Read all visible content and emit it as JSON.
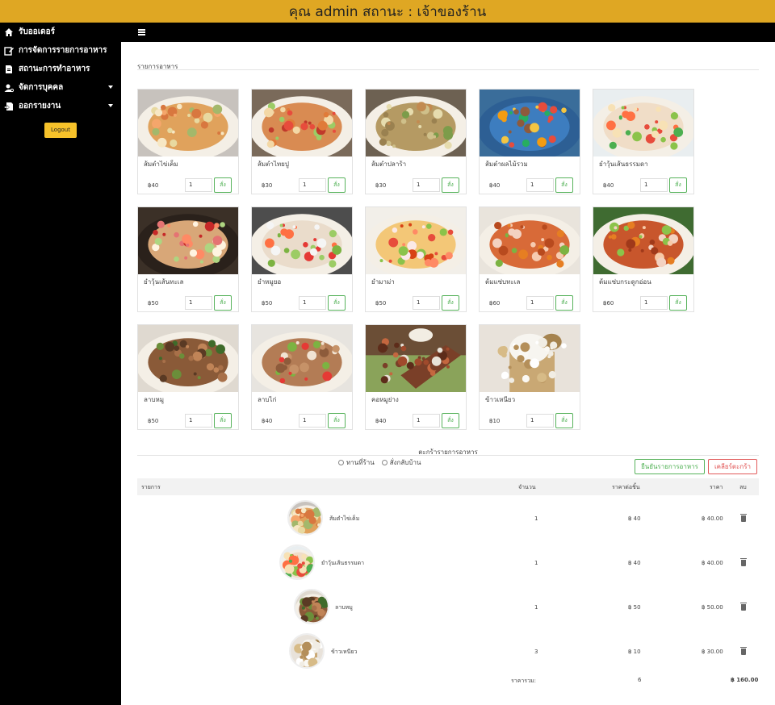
{
  "header": {
    "title": "คุณ admin สถานะ : เจ้าของร้าน"
  },
  "sidebar": {
    "items": [
      {
        "label": "รับออเดอร์",
        "icon": "home-icon",
        "has_caret": false
      },
      {
        "label": "การจัดการรายการอาหาร",
        "icon": "edit-icon",
        "has_caret": false
      },
      {
        "label": "สถานะการทำอาหาร",
        "icon": "file-icon",
        "has_caret": false
      },
      {
        "label": "จัดการบุคคล",
        "icon": "user-cog-icon",
        "has_caret": true
      },
      {
        "label": "ออกรายงาน",
        "icon": "report-icon",
        "has_caret": true
      }
    ],
    "logout_label": "Logout"
  },
  "menu": {
    "section_title": "รายการอาหาร",
    "order_label": "สั่ง",
    "items": [
      {
        "name": "ส้มตำไข่เค็ม",
        "price": "฿40",
        "qty": "1",
        "image": "papaya-salad-salted-egg"
      },
      {
        "name": "ส้มตำไทยปู",
        "price": "฿30",
        "qty": "1",
        "image": "papaya-salad-crab"
      },
      {
        "name": "ส้มตำปลาร้า",
        "price": "฿30",
        "qty": "1",
        "image": "papaya-salad-pickled-fish"
      },
      {
        "name": "ส้มตำผลไม้รวม",
        "price": "฿40",
        "qty": "1",
        "image": "fruit-salad"
      },
      {
        "name": "ยำวุ้นเส้นธรรมดา",
        "price": "฿40",
        "qty": "1",
        "image": "glass-noodle-salad"
      },
      {
        "name": "ยำวุ้นเส้นทะเล",
        "price": "฿50",
        "qty": "1",
        "image": "seafood-glass-noodle-salad"
      },
      {
        "name": "ยำหมูยอ",
        "price": "฿50",
        "qty": "1",
        "image": "pork-sausage-salad"
      },
      {
        "name": "ยำมาม่า",
        "price": "฿50",
        "qty": "1",
        "image": "instant-noodle-salad"
      },
      {
        "name": "ต้มแซ่บทะเล",
        "price": "฿60",
        "qty": "1",
        "image": "spicy-seafood-soup"
      },
      {
        "name": "ต้มแซ่บกระดูกอ่อน",
        "price": "฿60",
        "qty": "1",
        "image": "spicy-pork-soup"
      },
      {
        "name": "ลาบหมู",
        "price": "฿50",
        "qty": "1",
        "image": "pork-larb"
      },
      {
        "name": "ลาบไก่",
        "price": "฿40",
        "qty": "1",
        "image": "chicken-larb"
      },
      {
        "name": "คอหมูย่าง",
        "price": "฿40",
        "qty": "1",
        "image": "grilled-pork-neck"
      },
      {
        "name": "ข้าวเหนียว",
        "price": "฿10",
        "qty": "1",
        "image": "sticky-rice"
      }
    ]
  },
  "cart": {
    "title": "ตะกร้ารายการอาหาร",
    "options": [
      "ทานที่ร้าน",
      "สั่งกลับบ้าน"
    ],
    "confirm_label": "ยืนยันรายการอาหาร",
    "clear_label": "เคลียร์ตะกร้า",
    "columns": [
      "รายการ",
      "จำนวน",
      "ราคาต่อชิ้น",
      "ราคา",
      "ลบ"
    ],
    "rows": [
      {
        "name": "ส้มตำไข่เค็ม",
        "qty": "1",
        "unit": "฿ 40",
        "price": "฿ 40.00",
        "image": "papaya-salad-salted-egg"
      },
      {
        "name": "ยำวุ้นเส้นธรรมดา",
        "qty": "1",
        "unit": "฿ 40",
        "price": "฿ 40.00",
        "image": "glass-noodle-salad"
      },
      {
        "name": "ลาบหมู",
        "qty": "1",
        "unit": "฿ 50",
        "price": "฿ 50.00",
        "image": "pork-larb"
      },
      {
        "name": "ข้าวเหนียว",
        "qty": "3",
        "unit": "฿ 10",
        "price": "฿ 30.00",
        "image": "sticky-rice"
      }
    ],
    "total_label": "ราคารวม:",
    "total_qty": "6",
    "total_price": "฿ 160.00"
  },
  "colors": {
    "header_bg": "#dfa723",
    "sidebar_bg": "#000000",
    "logout_bg": "#f7c22a",
    "accent_green": "#4caf50",
    "accent_red": "#e05050"
  }
}
